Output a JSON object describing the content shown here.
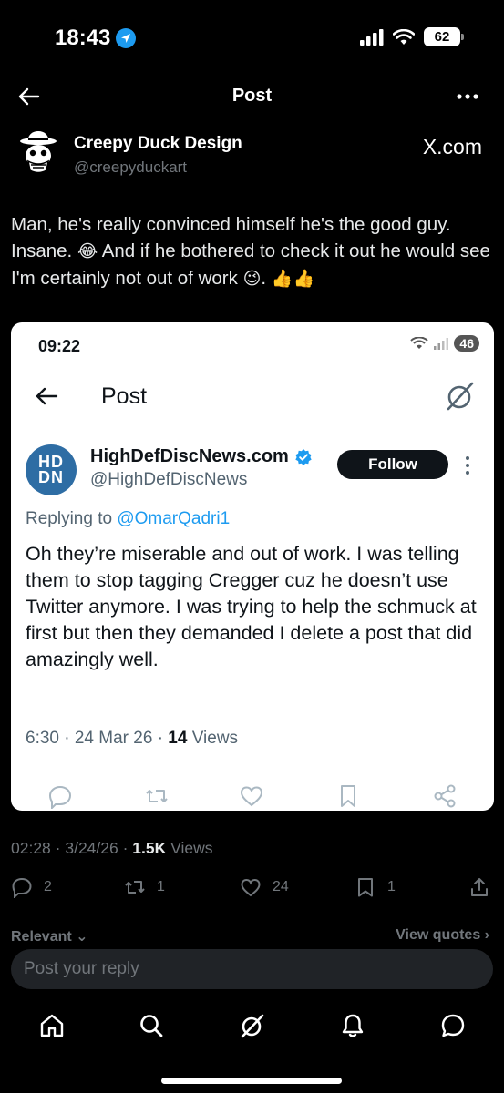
{
  "status_bar": {
    "time": "18:43",
    "battery": "62"
  },
  "nav": {
    "title": "Post"
  },
  "post": {
    "author_name": "Creepy Duck Design",
    "author_handle": "@creepyduckart",
    "source_label": "X.com",
    "text_part1": "Man, he's really convinced himself he's the good guy. Insane.",
    "emoji_joy": "😂",
    "text_part2": "And if he bothered to check it out he would see I'm certainly not out of work",
    "emoji_wink": "😉",
    "text_part3": ".",
    "emoji_thumbs": "👍👍",
    "timestamp": "02:28 · 3/24/26 · ",
    "views_count": "1.5K",
    "views_label": " Views",
    "replies": "2",
    "reposts": "1",
    "likes": "24",
    "bookmarks": "1"
  },
  "quoted_screenshot": {
    "status_time": "09:22",
    "battery": "46",
    "nav_title": "Post",
    "avatar_text_top": "HD",
    "avatar_text_bottom": "DN",
    "author_name": "HighDefDiscNews.com",
    "author_handle": "@HighDefDiscNews",
    "follow_label": "Follow",
    "replying_prefix": "Replying to ",
    "replying_to": "@OmarQadri1",
    "text": "Oh they’re miserable and out of work. I was telling them to stop tagging Cregger cuz he doesn’t use Twitter anymore. I was trying to help the schmuck at first but then they demanded I delete a post that did amazingly well.",
    "meta_prefix": "6:30 · 24 Mar 26 · ",
    "views_count": "14",
    "views_label": " Views"
  },
  "tabs": {
    "left": "Relevant ⌄",
    "right": "View quotes ›"
  },
  "reply": {
    "placeholder": "Post your reply"
  },
  "colors": {
    "accent": "#1d9bf0",
    "background": "#000000",
    "muted": "#71767b"
  }
}
